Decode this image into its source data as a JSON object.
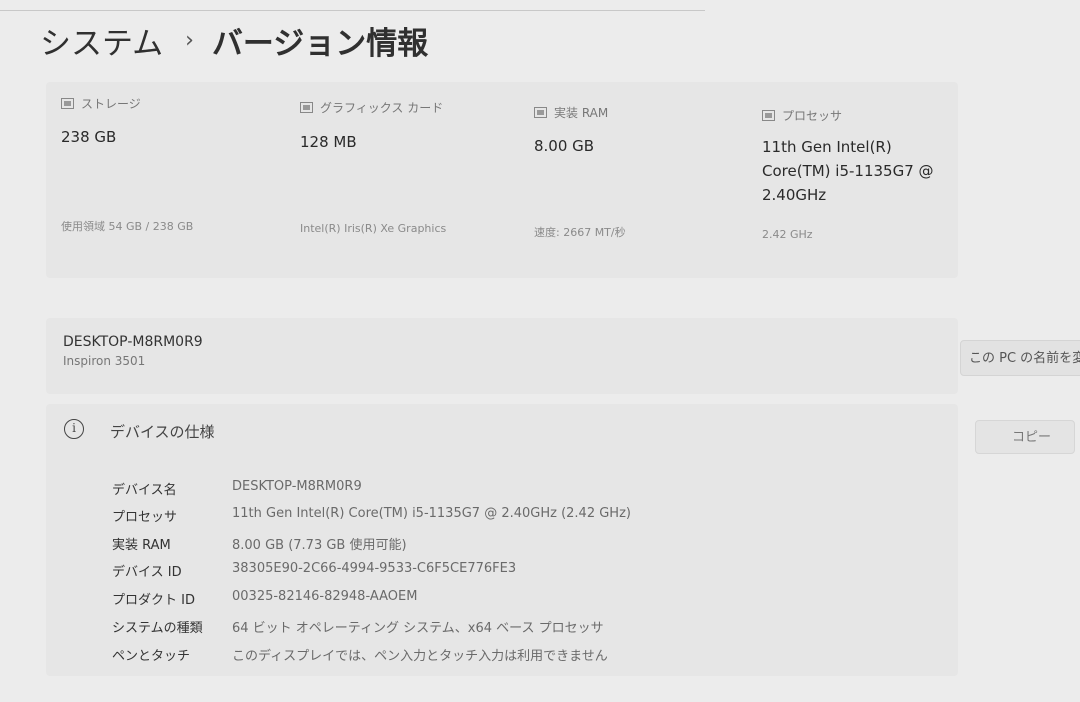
{
  "breadcrumb": {
    "parent": "システム",
    "separator": "›",
    "current": "バージョン情報"
  },
  "specs": [
    {
      "icon": "storage-icon",
      "label": "ストレージ",
      "value": "238 GB",
      "sub": "使用領域 54 GB / 238 GB"
    },
    {
      "icon": "graphics-card-icon",
      "label": "グラフィックス カード",
      "value": "128 MB",
      "sub": "Intel(R) Iris(R) Xe Graphics"
    },
    {
      "icon": "ram-icon",
      "label": "実装 RAM",
      "value": "8.00 GB",
      "sub": "速度: 2667 MT/秒"
    },
    {
      "icon": "processor-icon",
      "label": "プロセッサ",
      "value": "11th Gen Intel(R) Core(TM) i5-1135G7 @ 2.40GHz",
      "sub": "2.42 GHz"
    }
  ],
  "device": {
    "name": "DESKTOP-M8RM0R9",
    "model": "Inspiron 3501",
    "rename_label": "この PC の名前を変"
  },
  "device_specs": {
    "title": "デバイスの仕様",
    "copy_label": "コピー",
    "rows": [
      {
        "key": "デバイス名",
        "value": "DESKTOP-M8RM0R9"
      },
      {
        "key": "プロセッサ",
        "value": "11th Gen Intel(R) Core(TM) i5-1135G7 @ 2.40GHz (2.42 GHz)"
      },
      {
        "key": "実装 RAM",
        "value": "8.00 GB (7.73 GB 使用可能)"
      },
      {
        "key": "デバイス ID",
        "value": "38305E90-2C66-4994-9533-C6F5CE776FE3"
      },
      {
        "key": "プロダクト ID",
        "value": "00325-82146-82948-AAOEM"
      },
      {
        "key": "システムの種類",
        "value": "64 ビット オペレーティング システム、x64 ベース プロセッサ"
      },
      {
        "key": "ペンとタッチ",
        "value": "このディスプレイでは、ペン入力とタッチ入力は利用できません"
      }
    ]
  }
}
